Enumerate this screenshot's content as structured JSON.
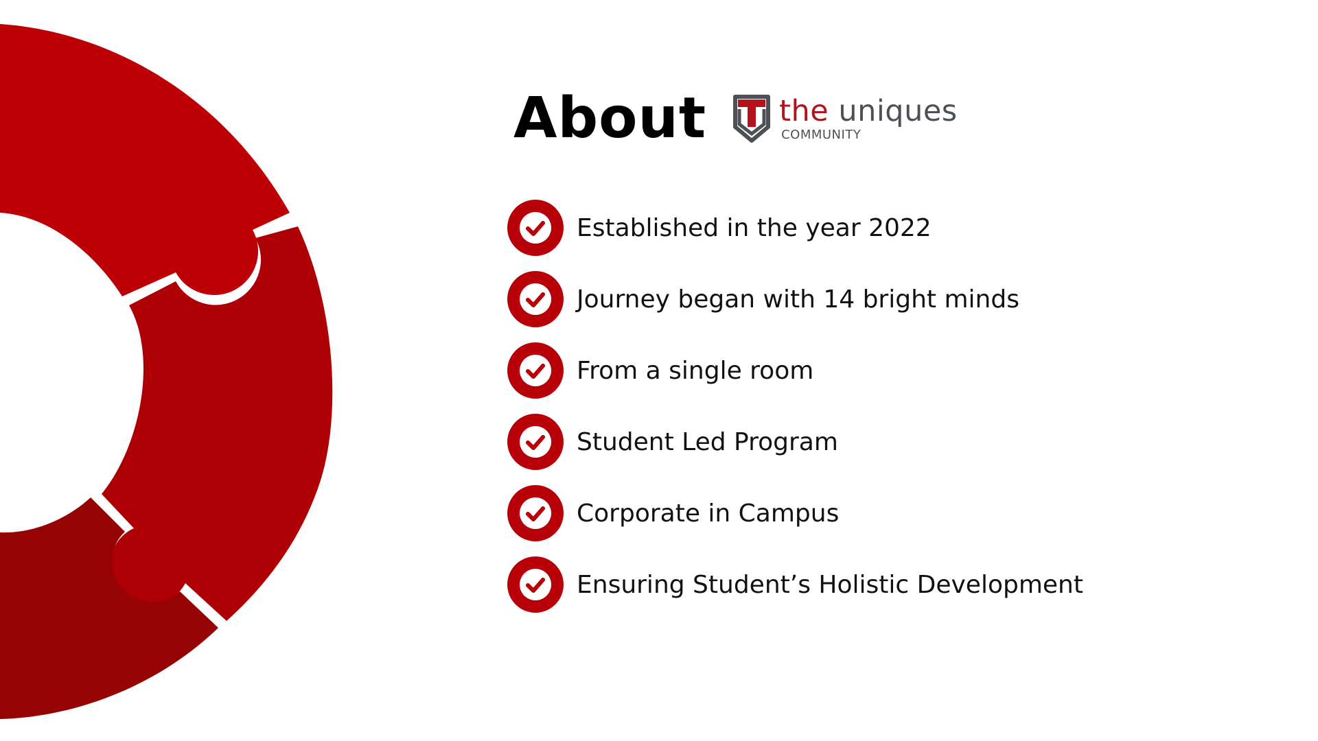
{
  "title": "About",
  "logo": {
    "name_part1": "the",
    "name_part2": "uniques",
    "subtitle": "COMMUNITY",
    "icon": "shield-tu-logo-icon"
  },
  "features": [
    {
      "text": "Established in the year 2022",
      "icon": "check-circle-icon"
    },
    {
      "text": "Journey began with 14 bright minds",
      "icon": "check-circle-icon"
    },
    {
      "text": "From a single room",
      "icon": "check-circle-icon"
    },
    {
      "text": "Student Led Program",
      "icon": "check-circle-icon"
    },
    {
      "text": "Corporate in Campus",
      "icon": "check-circle-icon"
    },
    {
      "text": "Ensuring Student’s Holistic Development",
      "icon": "check-circle-icon"
    }
  ],
  "colors": {
    "segment_top": "#bd0006",
    "segment_middle": "#ae0004",
    "segment_bottom": "#950303",
    "check_circle": "#b80008",
    "logo_red": "#b5121b",
    "logo_gray": "#4d5156"
  }
}
